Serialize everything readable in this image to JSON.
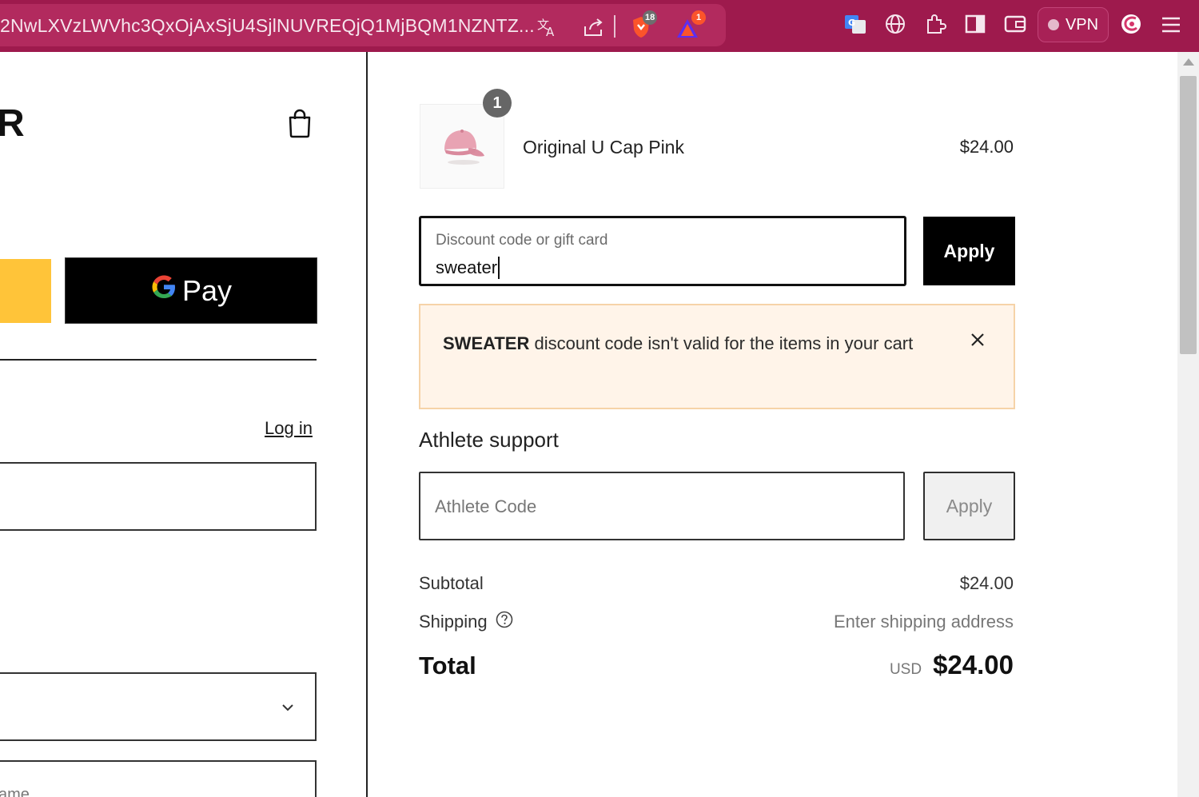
{
  "browser": {
    "url": "2NwLXVzLWVhc3QxOjAxSjU4SjlNUVREQjQ1MjBQM1NZNTZ...",
    "shield_badge": "18",
    "rewards_badge": "1",
    "vpn_label": "VPN"
  },
  "left": {
    "logo_letter": "R",
    "gpay_label": "Pay",
    "login_link": "Log in",
    "name_placeholder": "ame"
  },
  "cart": {
    "item_quantity": "1",
    "item_name": "Original U Cap Pink",
    "item_price": "$24.00",
    "thumbnail": "pink-cap-image"
  },
  "discount": {
    "label": "Discount code or gift card",
    "value": "sweater",
    "apply_label": "Apply",
    "alert_code": "SWEATER",
    "alert_message": " discount code isn't valid for the items in your cart"
  },
  "athlete": {
    "heading": "Athlete support",
    "placeholder": "Athlete Code",
    "apply_label": "Apply"
  },
  "summary": {
    "subtotal_label": "Subtotal",
    "subtotal_value": "$24.00",
    "shipping_label": "Shipping",
    "shipping_value": "Enter shipping address",
    "total_label": "Total",
    "currency": "USD",
    "total_value": "$24.00"
  },
  "colors": {
    "browser_toolbar": "#9e1a4d",
    "alert_background": "#fff4e9",
    "alert_border": "#f6d3a8",
    "gpay_blue": "#4285f4",
    "gpay_red": "#ea4335",
    "gpay_yellow": "#fbbc05",
    "gpay_green": "#34a853",
    "paypal_yellow": "#ffc439"
  }
}
